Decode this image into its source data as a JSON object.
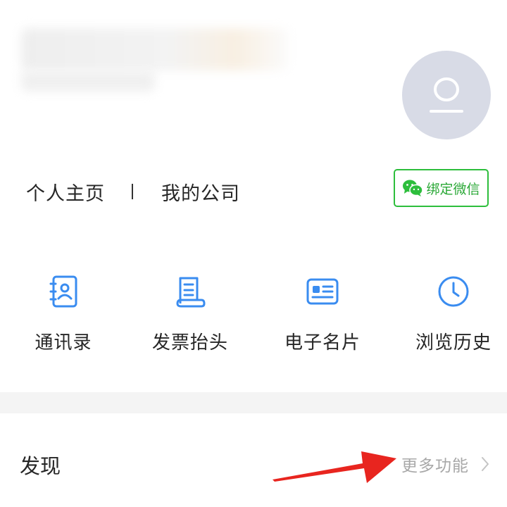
{
  "profile": {
    "avatar_icon": "user-avatar-placeholder-icon"
  },
  "links": {
    "homepage": "个人主页",
    "separator": "|",
    "company": "我的公司"
  },
  "wechat": {
    "label": "绑定微信",
    "icon": "wechat-icon",
    "color": "#2dbe3c"
  },
  "shortcuts": [
    {
      "label": "通讯录",
      "icon": "contacts-book-icon"
    },
    {
      "label": "发票抬头",
      "icon": "invoice-document-icon"
    },
    {
      "label": "电子名片",
      "icon": "business-card-icon"
    },
    {
      "label": "浏览历史",
      "icon": "clock-icon"
    }
  ],
  "discover": {
    "title": "发现",
    "more_label": "更多功能",
    "more_icon": "chevron-right-icon"
  },
  "annotation": {
    "icon": "red-arrow-icon",
    "color": "#e8251f"
  },
  "colors": {
    "icon_blue": "#3a8cf0",
    "wechat_green": "#2dbe3c",
    "avatar_bg": "#d8dbe6",
    "muted_text": "#a8a8a8"
  }
}
